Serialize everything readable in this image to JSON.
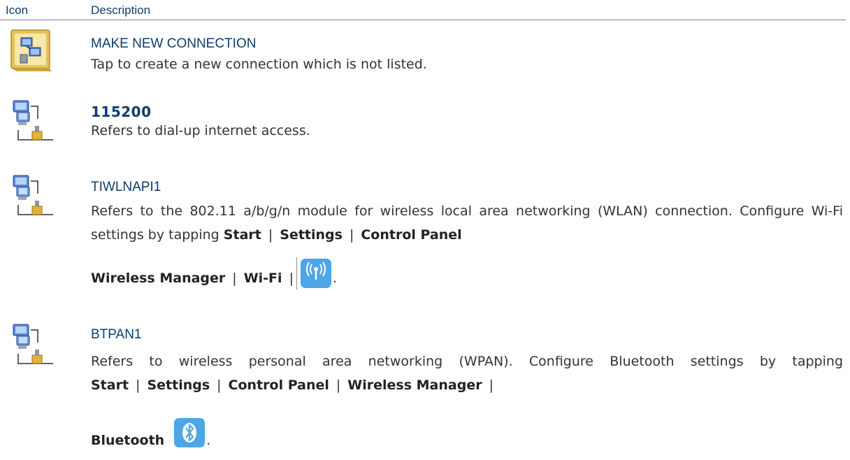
{
  "table": {
    "col_icon": "Icon",
    "col_description": "Description"
  },
  "rows": [
    {
      "icon": "make-new-connection-icon",
      "title": "MAKE NEW CONNECTION",
      "text": "Tap to create a new connection which is not listed."
    },
    {
      "icon": "network-connection-icon",
      "title": "115200",
      "text": "Refers to dial-up internet access."
    },
    {
      "icon": "network-connection-icon",
      "title": "TIWLNAPI1",
      "text_a": "Refers to the 802.11 a/b/g/n module for wireless local area networking (WLAN) connection. Configure Wi-Fi settings by tapping ",
      "path": [
        "Start",
        "Settings",
        "Control Panel",
        "Wireless Manager",
        "Wi-Fi"
      ],
      "separator": "|",
      "end": ".",
      "inline_icon": "wifi-icon"
    },
    {
      "icon": "network-connection-icon",
      "title": "BTPAN1",
      "text_a": "Refers to wireless personal area networking (WPAN). Configure Bluetooth settings by tapping ",
      "path": [
        "Start",
        "Settings",
        "Control Panel",
        "Wireless Manager",
        "Bluetooth"
      ],
      "separator": "|",
      "end": ".",
      "inline_icon": "bluetooth-icon"
    }
  ]
}
